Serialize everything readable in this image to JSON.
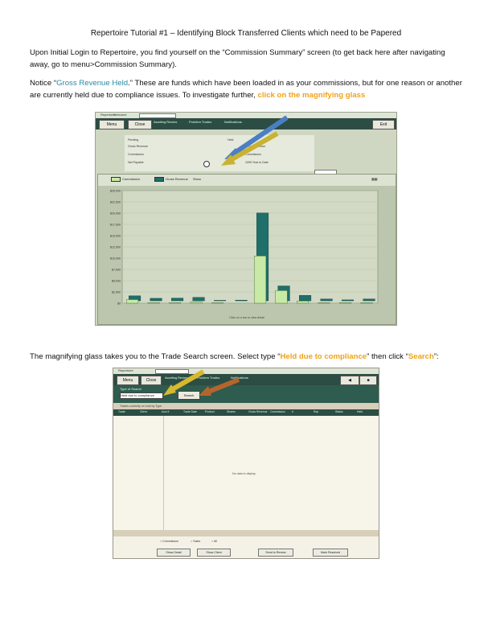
{
  "title": "Repertoire Tutorial #1 – Identifying Block Transferred Clients which need to be Papered",
  "para1": "Upon Initial Login to Repertoire, you find yourself on the “Commission Summary” screen (to get back here after navigating away, go to menu>Commission Summary).",
  "para2": {
    "a": "Notice “",
    "highlight": "Gross Revenue Held",
    "b": ".”  These are funds which have been loaded in as your commissions, but for one reason or another are currently held due to compliance issues.  To investigate further, ",
    "link": "click on the magnifying glass"
  },
  "para3": {
    "a": "The magnifying glass takes you to the Trade Search screen.  Select type “",
    "type": "Held due to compliance",
    "b": "” then click “",
    "search": "Search",
    "c": "”:"
  },
  "shot1": {
    "tab": "Repertoire",
    "tab2": "Welcome",
    "menu_btn": "Menu",
    "close_btn": "Close",
    "exit_btn": "Exit",
    "hdr1": "Awaiting Review",
    "hdr2": "Problem Trades",
    "hdr3": "Notifications",
    "info_title": "Pending",
    "info_label1": "Gross Revenue",
    "info_label2": "Commission",
    "info_label3": "Net Payable",
    "held_label": "Held",
    "gross_label": "Gross Revenue",
    "comm_label": "Commission",
    "ytd_label": "1099 Year to Date",
    "legend1": "Commission",
    "legend2": "Gross Revenue",
    "show_label": "Show",
    "footer": "Click on a bar to view detail"
  },
  "chart_data": {
    "type": "bar",
    "categories": [
      "",
      "",
      "",
      "",
      "",
      "",
      "",
      "",
      "",
      "",
      "",
      ""
    ],
    "series": [
      {
        "name": "Commission",
        "values": [
          800,
          150,
          120,
          250,
          100,
          0,
          10500,
          2800,
          500,
          100,
          150,
          120
        ]
      },
      {
        "name": "Gross Revenue",
        "values": [
          1100,
          550,
          600,
          750,
          100,
          150,
          19500,
          3300,
          1200,
          400,
          200,
          400
        ]
      }
    ],
    "colors": {
      "commission": "#c8eaa6",
      "gross_revenue": "#1f6f6a"
    },
    "ylim": [
      0,
      25000
    ],
    "yticks": [
      "$25,000",
      "$22,500",
      "$20,000",
      "$17,500",
      "$15,000",
      "$12,500",
      "$10,000",
      "$7,500",
      "$5,000",
      "$2,500",
      "$0"
    ]
  },
  "shot2": {
    "tab": "Repertoire",
    "type_label": "Type of Search",
    "select_value": "Held due to compliance",
    "search_btn": "Search",
    "filter": "Trades currently on hold by Type",
    "columns": [
      "Trade",
      "Client",
      "Acct #",
      "Trade Date",
      "Product",
      "Shares",
      "Gross Revenue",
      "Commission",
      "#",
      "Rep",
      "Status",
      "Held"
    ],
    "empty": "No data to display",
    "radio1": "Commission",
    "radio2": "Sales",
    "radio3": "All",
    "bottom_btns": [
      "Show Detail",
      "Show Client",
      "Send to Review",
      "Mark Resolved"
    ]
  }
}
